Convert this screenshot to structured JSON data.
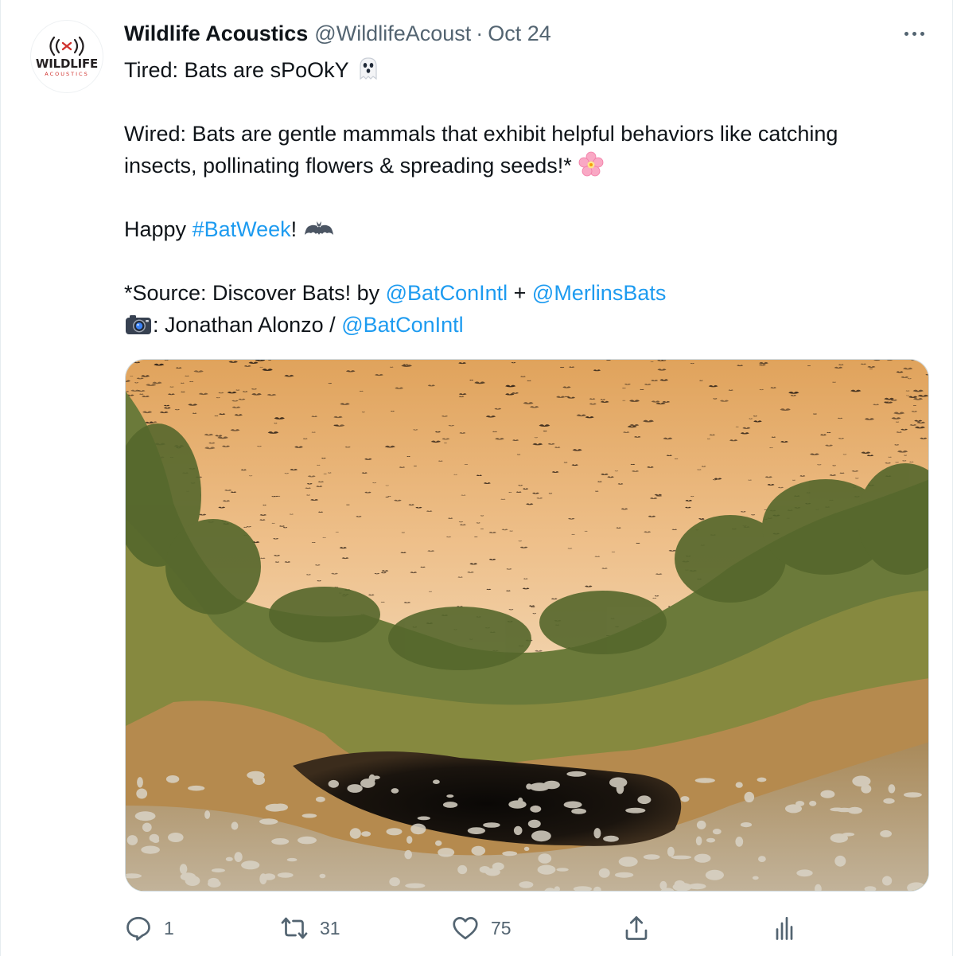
{
  "tweet": {
    "author_name": "Wildlife Acoustics",
    "author_handle": "@WildlifeAcoust",
    "separator": "·",
    "date": "Oct 24",
    "avatar": {
      "logo_text": "WILDLIFE",
      "logo_subtext": "ACOUSTICS",
      "brand_color": "#d0312d"
    },
    "body": {
      "tired_prefix": "Tired:  Bats are sPoOkY ",
      "tired_emoji": "ghost-icon",
      "wired_line1": "Wired:  Bats are gentle mammals that exhibit helpful behaviors like catching",
      "wired_line2": "insects, pollinating flowers & spreading seeds!* ",
      "wired_emoji": "cherry-blossom-icon",
      "happy_prefix": "Happy ",
      "hashtag": "#BatWeek",
      "happy_suffix": "! ",
      "happy_emoji": "bat-icon",
      "source_prefix": "*Source: Discover Bats! by ",
      "source_mention1": "@BatConIntl",
      "source_joiner": " + ",
      "source_mention2": "@MerlinsBats",
      "photo_emoji": "camera-icon",
      "photo_credit": ": Jonathan Alonzo / ",
      "photo_mention": "@BatConIntl"
    },
    "media": {
      "description_icon": "photo"
    },
    "stats": {
      "replies": "1",
      "retweets": "31",
      "likes": "75"
    },
    "colors": {
      "text": "#0f1419",
      "secondary": "#536471",
      "link": "#1d9bf0"
    }
  }
}
